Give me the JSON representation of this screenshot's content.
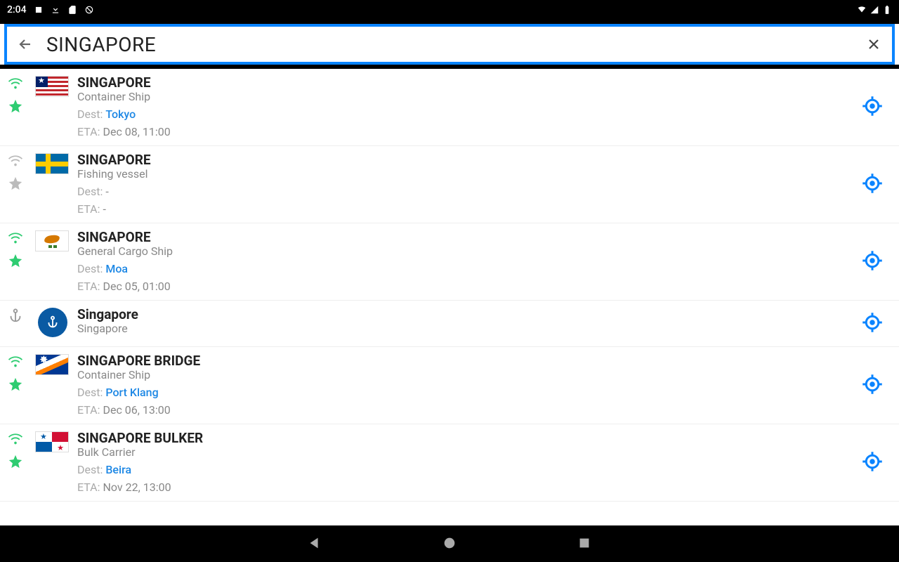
{
  "status": {
    "time": "2:04"
  },
  "search": {
    "value": "SINGAPORE"
  },
  "labels": {
    "dest": "Dest:",
    "eta": "ETA:"
  },
  "rows": [
    {
      "kind": "vessel",
      "name": "SINGAPORE",
      "type": "Container Ship",
      "dest": "Tokyo",
      "eta": "Dec 08, 11:00",
      "wifi": true,
      "fav": true,
      "flag": "liberia"
    },
    {
      "kind": "vessel",
      "name": "SINGAPORE",
      "type": "Fishing vessel",
      "dest": "-",
      "eta": "-",
      "wifi": false,
      "fav": false,
      "flag": "sweden"
    },
    {
      "kind": "vessel",
      "name": "SINGAPORE",
      "type": "General Cargo Ship",
      "dest": "Moa",
      "eta": "Dec 05, 01:00",
      "wifi": true,
      "fav": true,
      "flag": "cyprus"
    },
    {
      "kind": "port",
      "name": "Singapore",
      "type": "Singapore"
    },
    {
      "kind": "vessel",
      "name": "SINGAPORE BRIDGE",
      "type": "Container Ship",
      "dest": "Port Klang",
      "eta": "Dec 06, 13:00",
      "wifi": true,
      "fav": true,
      "flag": "marshall"
    },
    {
      "kind": "vessel",
      "name": "SINGAPORE BULKER",
      "type": "Bulk Carrier",
      "dest": "Beira",
      "eta": "Nov 22, 13:00",
      "wifi": true,
      "fav": true,
      "flag": "panama"
    }
  ]
}
